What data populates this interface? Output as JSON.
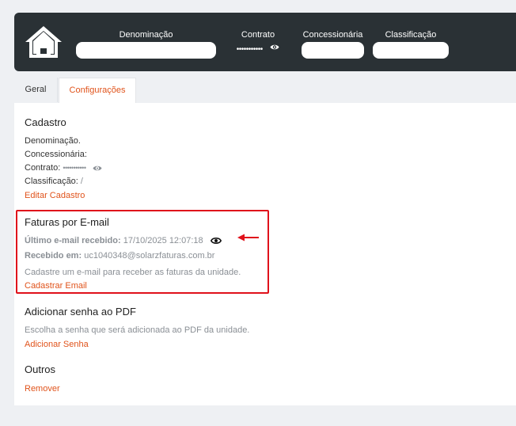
{
  "header": {
    "denominacao_label": "Denominação",
    "contrato_label": "Contrato",
    "contrato_masked": "•••••••••••",
    "concessionaria_label": "Concessionária",
    "classificacao_label": "Classificação"
  },
  "tabs": [
    {
      "label": "Geral",
      "active": false
    },
    {
      "label": "Configurações",
      "active": true
    }
  ],
  "cadastro": {
    "title": "Cadastro",
    "denominacao": "Denominação.",
    "concessionaria": "Concessionária:",
    "contrato_label": "Contrato:",
    "contrato_masked": "•••••••••••",
    "classificacao_label": "Classificação:",
    "classificacao_value": "/",
    "edit_link": "Editar Cadastro"
  },
  "faturas": {
    "title": "Faturas por E-mail",
    "ultimo_label": "Último e-mail recebido:",
    "ultimo_value": "17/10/2025 12:07:18",
    "recebido_label": "Recebido em:",
    "recebido_value": "uc1040348@solarzfaturas.com.br",
    "description": "Cadastre um e-mail para receber as faturas da unidade.",
    "link": "Cadastrar Email"
  },
  "senha": {
    "title": "Adicionar senha ao PDF",
    "description": "Escolha a senha que será adicionada ao PDF da unidade.",
    "link": "Adicionar Senha"
  },
  "outros": {
    "title": "Outros",
    "link": "Remover"
  },
  "colors": {
    "accent": "#e0531b",
    "header_bg": "#2a3135",
    "highlight": "#e0111b"
  }
}
